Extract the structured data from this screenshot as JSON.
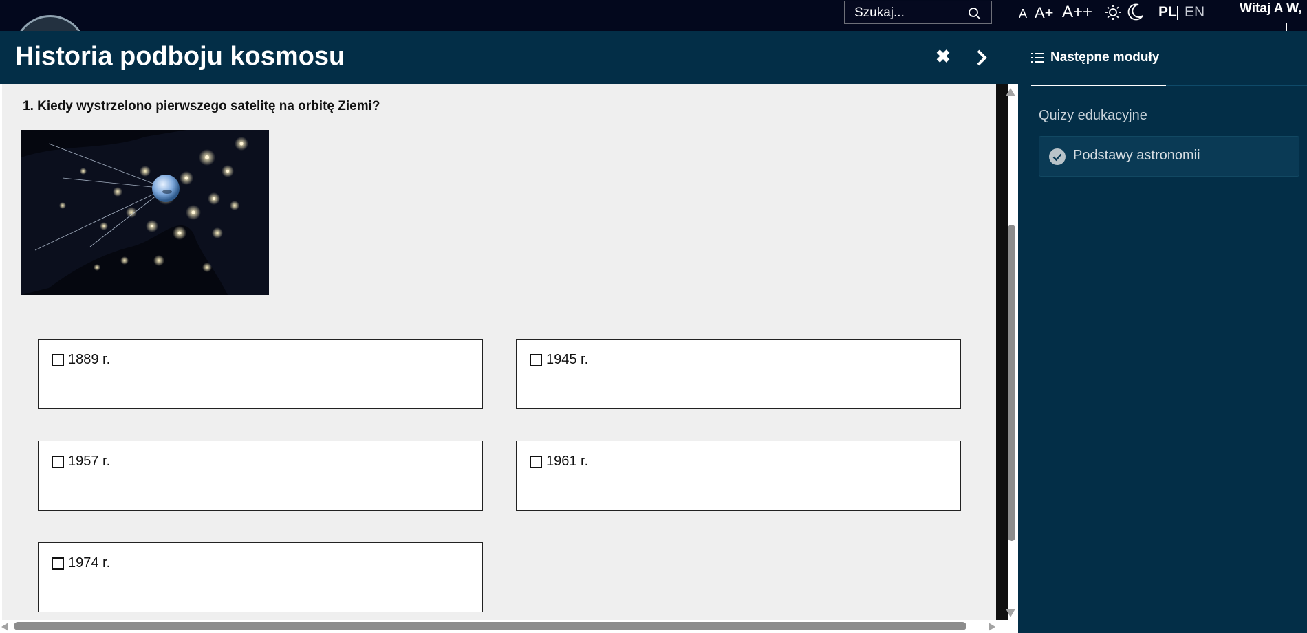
{
  "topbar": {
    "search_placeholder": "Szukaj...",
    "font_sizes": [
      "A",
      "A+",
      "A++"
    ],
    "languages": {
      "active": "PL",
      "other": "EN"
    },
    "greeting": "Witaj A W,"
  },
  "header": {
    "title": "Historia podboju kosmosu",
    "close_symbol": "✖",
    "next_icon": "chevron-right-icon"
  },
  "sidebar": {
    "tab_label": "Następne moduły",
    "section_title": "Quizy edukacyjne",
    "modules": [
      {
        "label": "Podstawy astronomii",
        "completed": true
      }
    ]
  },
  "quiz": {
    "question": "1. Kiedy wystrzelono pierwszego satelitę na orbitę Ziemi?",
    "image_alt": "Sputnik nad nocną mapą Ameryki Północnej",
    "answers": [
      {
        "label": "1889 r.",
        "checked": false
      },
      {
        "label": "1945 r.",
        "checked": false
      },
      {
        "label": "1957 r.",
        "checked": false
      },
      {
        "label": "1961 r.",
        "checked": false
      },
      {
        "label": "1974 r.",
        "checked": false
      }
    ]
  },
  "colors": {
    "topbar": "#03081d",
    "header": "#032e47",
    "sidebar": "#032e47",
    "content_bg": "#efefef"
  }
}
